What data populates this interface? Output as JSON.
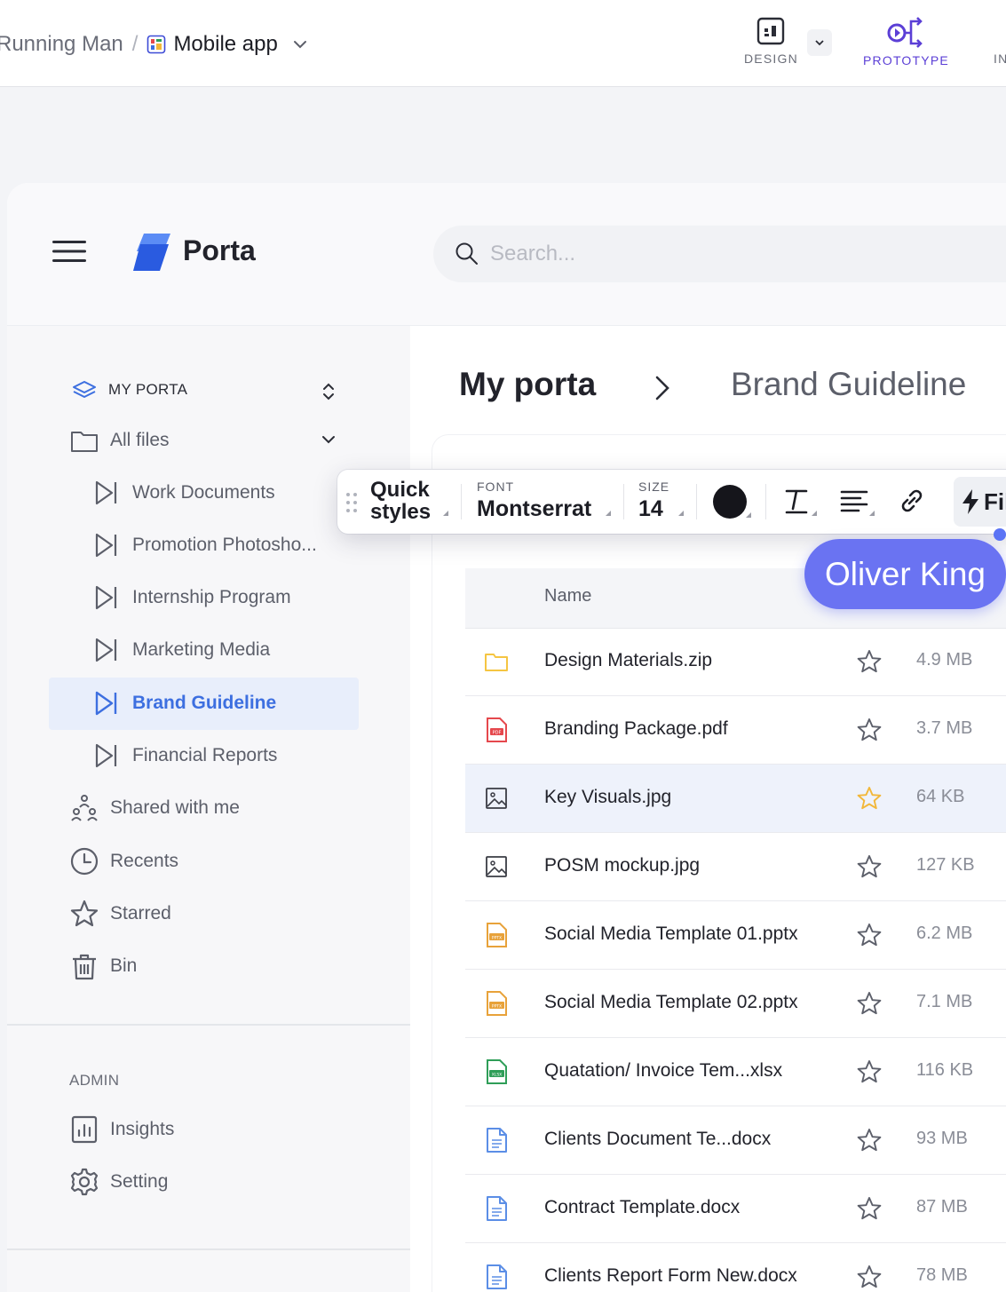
{
  "editor": {
    "breadcrumb_parent": "Running Man",
    "breadcrumb_sep": "/",
    "breadcrumb_current": "Mobile app",
    "modes": {
      "design": "DESIGN",
      "prototype": "PROTOTYPE",
      "third": "IN"
    }
  },
  "app": {
    "brand": "Porta",
    "search_placeholder": "Search...",
    "sidebar": {
      "section": "MY PORTA",
      "all_files": "All files",
      "folders": [
        "Work Documents",
        "Promotion Photosho...",
        "Internship Program",
        "Marketing Media",
        "Brand Guideline",
        "Financial Reports"
      ],
      "active_folder": "Brand Guideline",
      "nav": [
        "Shared with me",
        "Recents",
        "Starred",
        "Bin"
      ],
      "admin_label": "ADMIN",
      "admin_items": [
        "Insights",
        "Setting"
      ]
    },
    "heading": {
      "root": "My porta",
      "current": "Brand Guideline"
    },
    "table": {
      "name_header": "Name",
      "rows": [
        {
          "name": "Design Materials.zip",
          "size": "4.9 MB",
          "type": "folder",
          "starred": false,
          "highlighted": false
        },
        {
          "name": "Branding Package.pdf",
          "size": "3.7 MB",
          "type": "pdf",
          "starred": false,
          "highlighted": false
        },
        {
          "name": "Key Visuals.jpg",
          "size": "64 KB",
          "type": "image",
          "starred": true,
          "highlighted": true
        },
        {
          "name": "POSM mockup.jpg",
          "size": "127 KB",
          "type": "image",
          "starred": false,
          "highlighted": false
        },
        {
          "name": "Social Media Template 01.pptx",
          "size": "6.2 MB",
          "type": "pptx",
          "starred": false,
          "highlighted": false
        },
        {
          "name": "Social Media Template 02.pptx",
          "size": "7.1 MB",
          "type": "pptx",
          "starred": false,
          "highlighted": false
        },
        {
          "name": "Quatation/ Invoice Tem...xlsx",
          "size": "116 KB",
          "type": "xlsx",
          "starred": false,
          "highlighted": false
        },
        {
          "name": "Clients Document Te...docx",
          "size": "93 MB",
          "type": "docx",
          "starred": false,
          "highlighted": false
        },
        {
          "name": "Contract Template.docx",
          "size": "87 MB",
          "type": "docx",
          "starred": false,
          "highlighted": false
        },
        {
          "name": "Clients Report Form New.docx",
          "size": "78 MB",
          "type": "docx",
          "starred": false,
          "highlighted": false
        }
      ]
    }
  },
  "text_toolbar": {
    "quick_styles_line1": "Quick",
    "quick_styles_line2": "styles",
    "font_caption": "FONT",
    "font_value": "Montserrat",
    "size_caption": "SIZE",
    "size_value": "14",
    "text_color": "#15151b",
    "fill_label": "Fil"
  },
  "collaborator_cursor": {
    "name": "Oliver King",
    "color": "#6a73f2"
  },
  "colors": {
    "accent_blue": "#3d6fe0",
    "prototype_purple": "#5b3fd6",
    "star_gold": "#f2b739",
    "folder_yellow": "#f5c542",
    "pdf_red": "#e5484d",
    "pptx_orange": "#e8a23a",
    "xlsx_green": "#2f9e58",
    "docx_blue": "#5b8ee6"
  }
}
